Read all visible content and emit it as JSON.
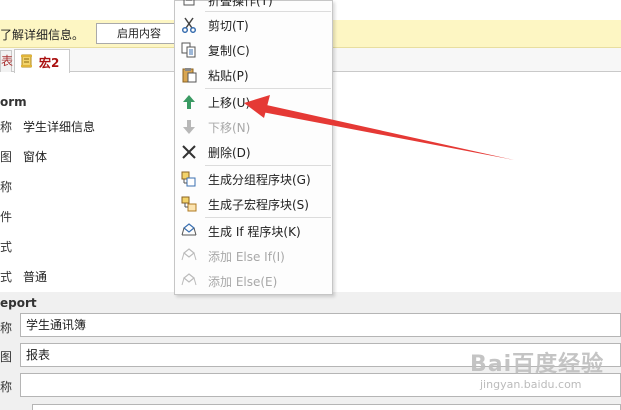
{
  "message_bar": {
    "text": "了解详细信息。",
    "enable_button": "启用内容"
  },
  "tabs": {
    "partial_tab": "表",
    "active_tab": "宏2"
  },
  "form_section": {
    "header": "orm",
    "rows": [
      {
        "label": "称",
        "value": "学生详细信息"
      },
      {
        "label": "图",
        "value": "窗体"
      },
      {
        "label": "称",
        "value": ""
      },
      {
        "label": "件",
        "value": ""
      },
      {
        "label": "式",
        "value": ""
      },
      {
        "label": "式",
        "value": "普通"
      }
    ]
  },
  "report_section": {
    "header": "eport",
    "rows": [
      {
        "label": "称",
        "value": "学生通讯簿"
      },
      {
        "label": "图",
        "value": "报表"
      },
      {
        "label": "称",
        "value": ""
      }
    ]
  },
  "context_menu": {
    "items": [
      {
        "label": "折叠操作(T)",
        "icon": "collapse-icon",
        "enabled": true
      },
      {
        "label": "剪切(T)",
        "icon": "scissors-icon",
        "enabled": true
      },
      {
        "label": "复制(C)",
        "icon": "copy-icon",
        "enabled": true
      },
      {
        "label": "粘贴(P)",
        "icon": "paste-icon",
        "enabled": true
      },
      {
        "label": "上移(U)",
        "icon": "arrow-up-icon",
        "enabled": true
      },
      {
        "label": "下移(N)",
        "icon": "arrow-down-icon",
        "enabled": false
      },
      {
        "label": "删除(D)",
        "icon": "delete-x-icon",
        "enabled": true
      },
      {
        "label": "生成分组程序块(G)",
        "icon": "group-block-icon",
        "enabled": true
      },
      {
        "label": "生成子宏程序块(S)",
        "icon": "submacro-block-icon",
        "enabled": true
      },
      {
        "label": "生成 If 程序块(K)",
        "icon": "if-block-icon",
        "enabled": true
      },
      {
        "label": "添加 Else If(I)",
        "icon": "else-if-icon",
        "enabled": false
      },
      {
        "label": "添加 Else(E)",
        "icon": "else-icon",
        "enabled": false
      }
    ]
  },
  "watermark": {
    "brand": "Bai百度经验",
    "site": "jingyan.baidu.com"
  },
  "colors": {
    "message_bar_bg": "#fdf6c3",
    "accent_red": "#e53935",
    "arrow_green": "#3a9a63",
    "tab_label": "#a11111"
  }
}
